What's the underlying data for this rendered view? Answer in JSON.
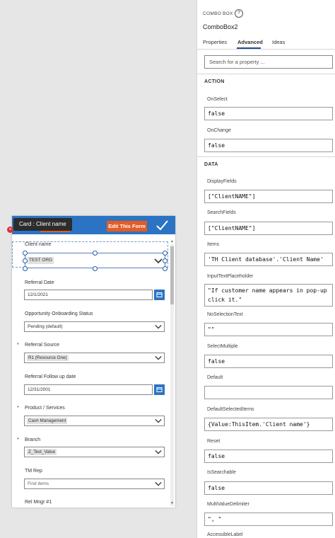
{
  "form": {
    "tooltip": "Card : Client name",
    "edit_label": "Edit This Form",
    "fields": [
      {
        "label": "Client name",
        "required": false,
        "value": "TEST ORG"
      },
      {
        "label": "Referral Date",
        "required": false,
        "value": "12/1/2021"
      },
      {
        "label": "Opportunity Onboarding Status",
        "required": false,
        "value": "Pending (default)"
      },
      {
        "label": "Referral Source",
        "required": true,
        "value": "R1 (Resource One)"
      },
      {
        "label": "Referral Follow up date",
        "required": false,
        "value": "12/31/2001"
      },
      {
        "label": "Product / Services",
        "required": true,
        "value": "Cash Management"
      },
      {
        "label": "Branch",
        "required": true,
        "value": "Z_Test_Value"
      },
      {
        "label": "TM Rep",
        "required": false,
        "value": "Find items"
      },
      {
        "label": "Rel Mngr #1",
        "required": false,
        "value": ""
      }
    ],
    "required_mark": "*"
  },
  "panel": {
    "type_label": "COMBO BOX",
    "control_name": "ComboBox2",
    "tabs": [
      "Properties",
      "Advanced",
      "Ideas"
    ],
    "active_tab": "Advanced",
    "search_placeholder": "Search for a property ...",
    "sections": {
      "action": "ACTION",
      "data": "DATA"
    },
    "properties": [
      {
        "name": "OnSelect",
        "value": "false"
      },
      {
        "name": "OnChange",
        "value": "false"
      },
      {
        "name": "DisplayFields",
        "value": "[\"ClientNAME\"]"
      },
      {
        "name": "SearchFields",
        "value": "[\"ClientNAME\"]"
      },
      {
        "name": "Items",
        "value": "'TH Client database'.'Client Name'"
      },
      {
        "name": "InputTextPlaceholder",
        "value": "\"If customer name appears in pop-up click it.\""
      },
      {
        "name": "NoSelectionText",
        "value": "\"\""
      },
      {
        "name": "SelectMultiple",
        "value": "false"
      },
      {
        "name": "Default",
        "value": ""
      },
      {
        "name": "DefaultSelectedItems",
        "value": "{Value:ThisItem.'Client name'}"
      },
      {
        "name": "Reset",
        "value": "false"
      },
      {
        "name": "IsSearchable",
        "value": "false"
      },
      {
        "name": "MultiValueDelimiter",
        "value": "\", \""
      },
      {
        "name": "AccessibleLabel",
        "value": ""
      }
    ]
  }
}
